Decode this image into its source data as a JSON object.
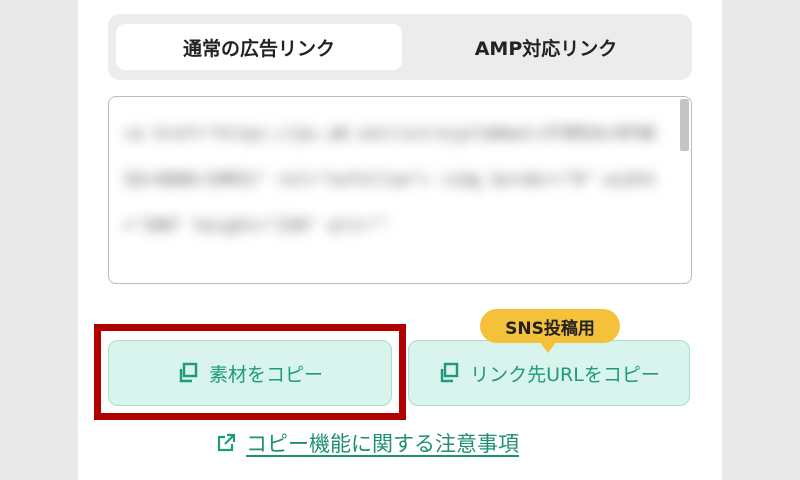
{
  "tabs": {
    "normal_label": "通常の広告リンク",
    "amp_label": "AMP対応リンク"
  },
  "code": {
    "text": "<a href=\"https://px.a8.net/svt/ejp?a8mat=3T8M2A+9FHBIQ+4Q6B+1HM31\" rel=\"nofollow\">\n<img border=\"0\" width=\"300\" height=\"250\" alt=\"\""
  },
  "buttons": {
    "copy_material_label": "素材をコピー",
    "copy_link_label": "リンク先URLをコピー",
    "sns_badge_label": "SNS投稿用"
  },
  "notice": {
    "label": "コピー機能に関する注意事項"
  },
  "colors": {
    "accent": "#1f9a7b",
    "button_bg": "#d8f4ec",
    "badge": "#f5c03a",
    "highlight": "#b10000"
  }
}
